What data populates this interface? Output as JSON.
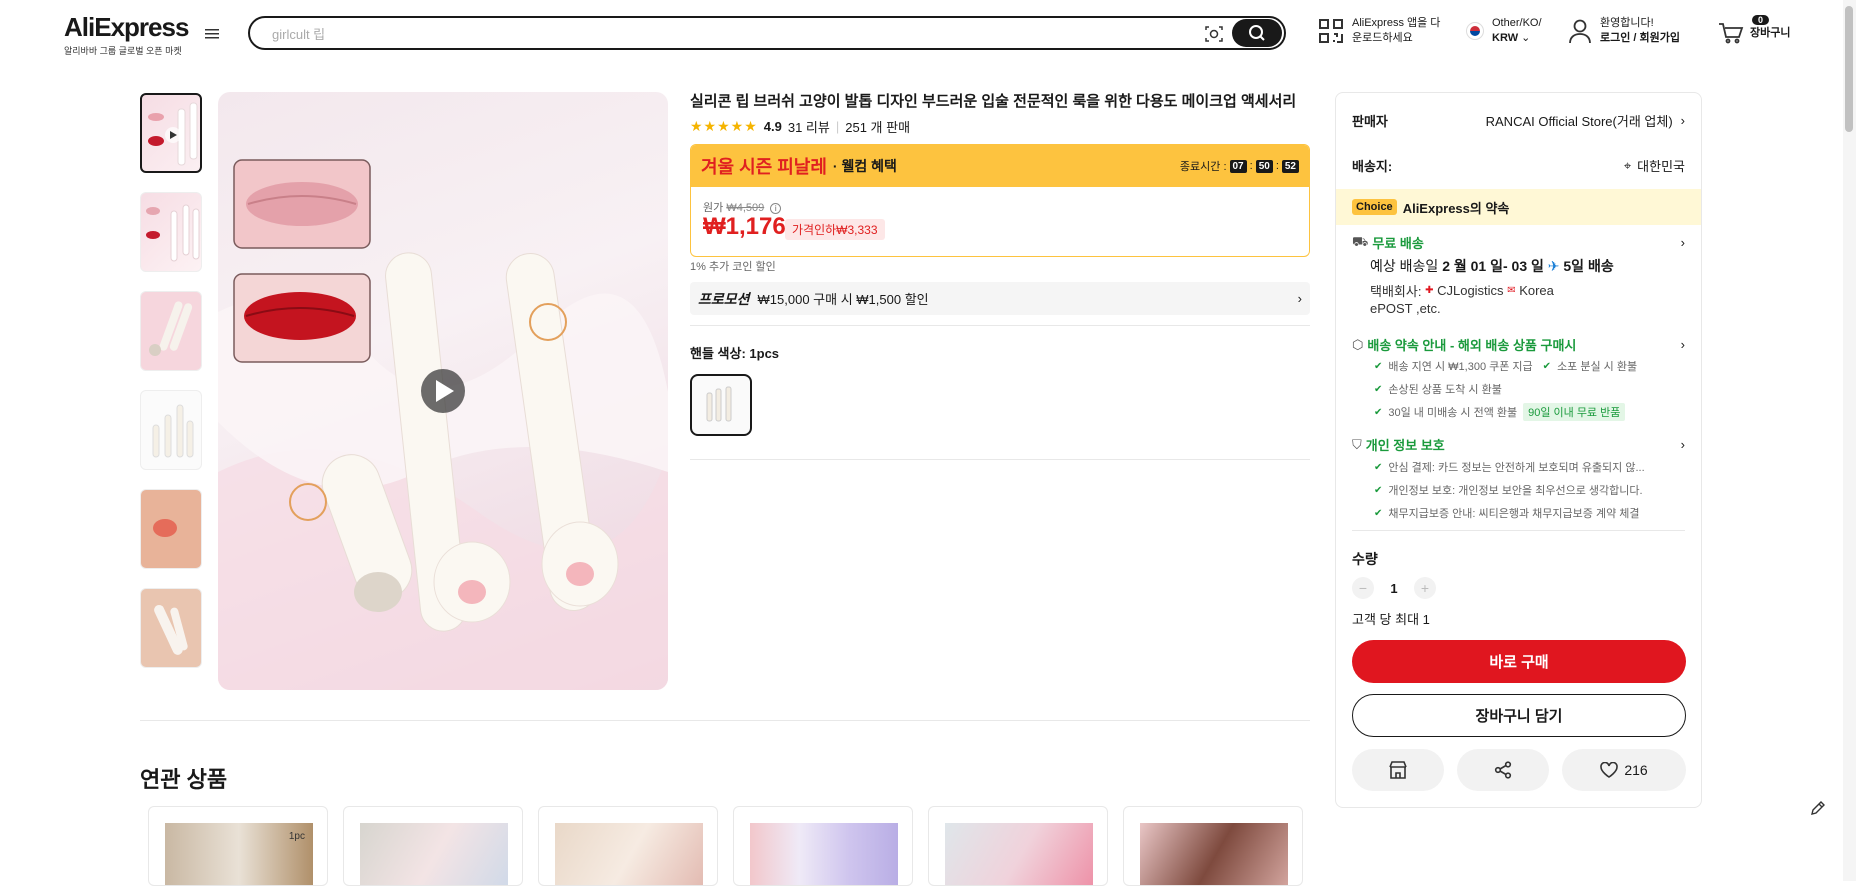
{
  "header": {
    "logo": "AliExpress",
    "logo_sub": "알리바바 그룹 글로벌 오픈 마켓",
    "search_placeholder": "girlcult 립",
    "app_line1": "AliExpress 앱을 다",
    "app_line2": "운로드하세요",
    "locale_line1": "Other/KO/",
    "locale_line2": "KRW",
    "welcome_line1": "환영합니다!",
    "welcome_line2": "로그인 / 회원가입",
    "cart_count": "0",
    "cart_label": "장바구니"
  },
  "product": {
    "title": "실리콘 립 브러쉬 고양이 발톱 디자인 부드러운 입술 전문적인 룩을 위한 다용도 메이크업 액세서리",
    "rating": "4.9",
    "reviews": "31 리뷰",
    "sold": "251 개 판매",
    "promo_title": "겨울 시즌 피날레",
    "promo_sub": "· 웰컴 혜택",
    "timer_label": "종료시간 :",
    "timer": [
      "07",
      "50",
      "52"
    ],
    "orig_label": "원가",
    "orig_price": "₩4,509",
    "price": "₩1,176",
    "discount": "가격인하₩3,333",
    "coin": "1% 추가 코인 할인",
    "promotion_tag": "프로모션",
    "promotion_text": "₩15,000 구매 시 ₩1,500 할인",
    "color_label": "핸들 색상: 1pcs"
  },
  "panel": {
    "seller_label": "판매자",
    "seller": "RANCAI Official Store(거래 업체)",
    "ship_label": "배송지:",
    "ship_to": "대한민국",
    "choice_tag": "Choice",
    "choice_text": "AliExpress의 약속",
    "free_ship": "무료 배송",
    "eta_prefix": "예상 배송일",
    "eta_dates": "2 월 01 일- 03 일",
    "eta_days": "5일 배송",
    "carrier_label": "택배회사:",
    "carrier1": "CJLogistics",
    "carrier2": "Korea",
    "carrier3": "ePOST ,etc.",
    "promise_title": "배송 약속 안내 - 해외 배송 상품 구매시",
    "promise_items": [
      "배송 지연 시 ₩1,300 쿠폰 지급",
      "소포 분실 시 환불",
      "손상된 상품 도착 시 환불",
      "30일 내 미배송 시 전액 환불"
    ],
    "promise_tag": "90일 이내 무료 반품",
    "privacy_title": "개인 정보 보호",
    "privacy_items": [
      "안심 결제: 카드 정보는 안전하게 보호되며 유출되지 않...",
      "개인정보 보호: 개인정보 보안을 최우선으로 생각합니다.",
      "채무지급보증 안내: 씨티은행과 채무지급보증 계약 체결"
    ],
    "qty_label": "수량",
    "qty_value": "1",
    "qty_limit": "고객 당 최대 1",
    "buy_now": "바로 구매",
    "add_cart": "장바구니 담기",
    "wishlist_count": "216"
  },
  "related": {
    "title": "연관 상품",
    "first_badge": "1pc"
  },
  "icons": [
    "menu-icon",
    "camera-search-icon",
    "search-icon",
    "qr-icon",
    "korea-flag-icon",
    "user-icon",
    "cart-icon",
    "play-icon",
    "info-icon",
    "chevron-right-icon",
    "location-icon",
    "truck-icon",
    "plane-icon",
    "shield-icon",
    "check-icon",
    "store-icon",
    "share-icon",
    "heart-icon",
    "edit-icon"
  ]
}
